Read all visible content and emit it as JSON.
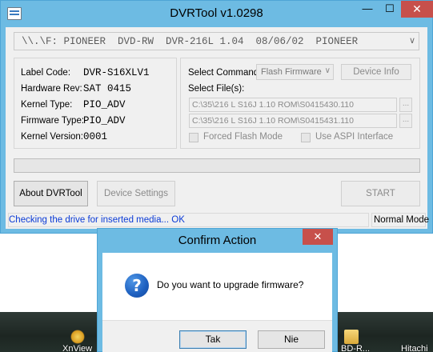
{
  "window": {
    "title": "DVRTool v1.0298",
    "minimize": "—",
    "maximize": "☐",
    "close": "✕"
  },
  "drive_path": "\\\\.\\F: PIONEER  DVD-RW  DVR-216L 1.04  08/06/02  PIONEER",
  "drive_info": [
    {
      "label": "Label Code:",
      "value": "DVR-S16XLV1"
    },
    {
      "label": "Hardware Rev:",
      "value": "SAT 0415"
    },
    {
      "label": "Kernel Type:",
      "value": "PIO_ADV"
    },
    {
      "label": "Firmware Type:",
      "value": "PIO_ADV"
    },
    {
      "label": "Kernel Version:",
      "value": "0001"
    }
  ],
  "command": {
    "label": "Select Command:",
    "selected": "Flash Firmware",
    "device_info_label": "Device Info",
    "files_label": "Select File(s):",
    "file1": "C:\\35\\216 L S16J 1.10 ROM\\S0415430.110",
    "file2": "C:\\35\\216 L S16J 1.10 ROM\\S0415431.110",
    "browse_label": "...",
    "forced_flash_label": "Forced Flash Mode",
    "aspi_label": "Use ASPI Interface"
  },
  "progress": {
    "fraction": 0.0
  },
  "buttons": {
    "about": "About DVRTool",
    "device_settings": "Device Settings",
    "start": "START"
  },
  "status": {
    "message": "Checking the drive for inserted media... OK",
    "mode": "Normal Mode"
  },
  "dialog": {
    "title": "Confirm Action",
    "close": "✕",
    "question_icon": "question-icon",
    "message": "Do you want to upgrade firmware?",
    "yes_label": "Tak",
    "no_label": "Nie"
  },
  "desktop": {
    "items": [
      "XnView",
      "BD-R...",
      "Hitachi"
    ]
  }
}
